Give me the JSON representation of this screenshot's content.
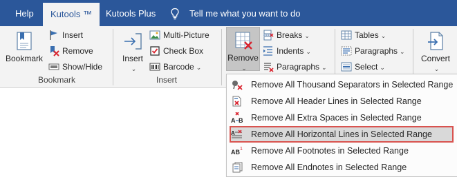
{
  "tabs": [
    {
      "label": "Help"
    },
    {
      "label": "Kutools ™"
    },
    {
      "label": "Kutools Plus"
    }
  ],
  "tell_me": "Tell me what you want to do",
  "groups": {
    "bookmark": {
      "label": "Bookmark",
      "big_button": "Bookmark",
      "insert": "Insert",
      "remove": "Remove",
      "show_hide": "Show/Hide"
    },
    "insert": {
      "label": "Insert",
      "big_button": "Insert",
      "multi_picture": "Multi-Picture",
      "check_box": "Check Box",
      "barcode": "Barcode"
    },
    "remove": {
      "big_button": "Remove",
      "breaks": "Breaks",
      "indents": "Indents",
      "paragraphs": "Paragraphs"
    },
    "select": {
      "tables": "Tables",
      "paragraphs": "Paragraphs",
      "select": "Select"
    },
    "convert": {
      "big_button": "Convert"
    }
  },
  "menu": {
    "items": [
      {
        "label": "Remove All Thousand Separators in Selected Range",
        "icon": "thousand-separator-icon"
      },
      {
        "label": "Remove All Header Lines in Selected Range",
        "icon": "header-lines-icon"
      },
      {
        "label": "Remove All Extra Spaces in Selected Range",
        "icon": "extra-spaces-icon"
      },
      {
        "label": "Remove All Horizontal Lines in Selected Range",
        "icon": "horizontal-lines-icon",
        "highlighted": true
      },
      {
        "label": "Remove All Footnotes in Selected Range",
        "icon": "footnote-icon"
      },
      {
        "label": "Remove All Endnotes in Selected Range",
        "icon": "endnote-icon"
      }
    ]
  },
  "colors": {
    "tab_bar": "#2b579a",
    "ribbon": "#f3f3f3",
    "highlight_border": "#d9534f",
    "remove_red": "#d9232e"
  }
}
